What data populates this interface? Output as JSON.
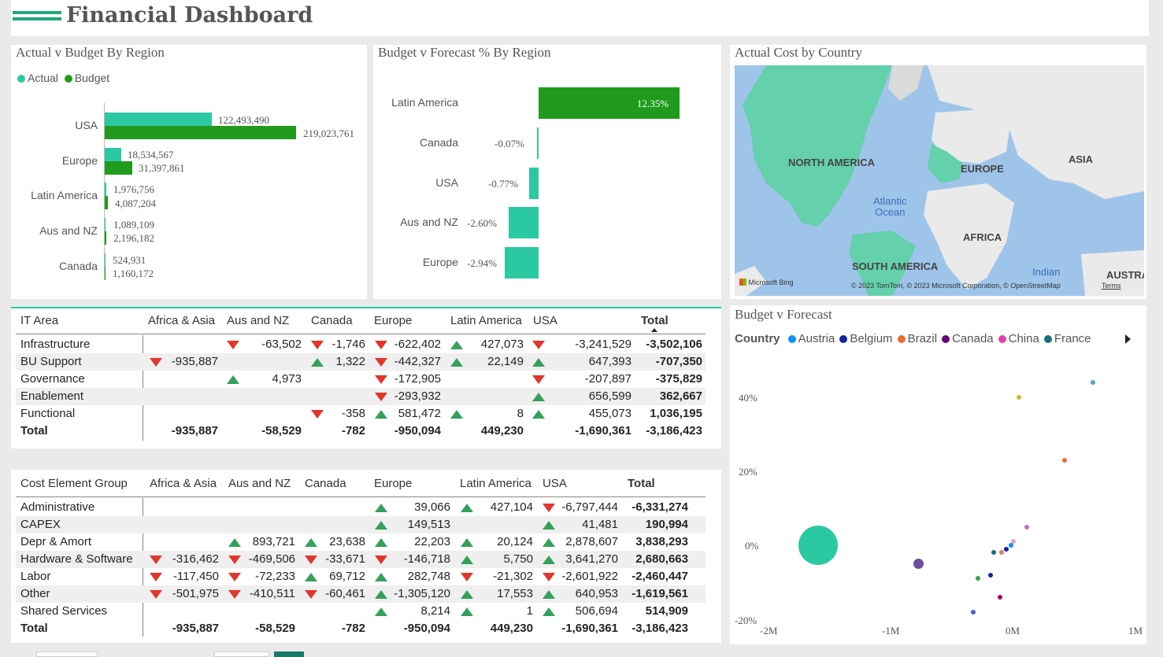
{
  "header": {
    "title": "Financial Dashboard"
  },
  "actual_v_budget": {
    "title": "Actual v Budget By Region",
    "legend": [
      {
        "label": "Actual",
        "color": "#2bc9a2"
      },
      {
        "label": "Budget",
        "color": "#209b1d"
      }
    ],
    "rows": [
      {
        "region": "USA",
        "actual": "122,493,490",
        "budget": "219,023,761"
      },
      {
        "region": "Europe",
        "actual": "18,534,567",
        "budget": "31,397,861"
      },
      {
        "region": "Latin America",
        "actual": "1,976,756",
        "budget": "4,087,204"
      },
      {
        "region": "Aus and NZ",
        "actual": "1,089,109",
        "budget": "2,196,182"
      },
      {
        "region": "Canada",
        "actual": "524,931",
        "budget": "1,160,172"
      }
    ]
  },
  "budget_v_forecast_pct": {
    "title": "Budget v Forecast % By Region",
    "rows": [
      {
        "region": "Latin America",
        "value": "12.35%"
      },
      {
        "region": "Canada",
        "value": "-0.07%"
      },
      {
        "region": "USA",
        "value": "-0.77%"
      },
      {
        "region": "Aus and NZ",
        "value": "-2.60%"
      },
      {
        "region": "Europe",
        "value": "-2.94%"
      }
    ]
  },
  "map": {
    "title": "Actual Cost by Country",
    "labels": {
      "north_america": "NORTH AMERICA",
      "europe": "EUROPE",
      "asia": "ASIA",
      "africa": "AFRICA",
      "south_america": "SOUTH AMERICA",
      "australia": "AUSTRA"
    },
    "oceans": {
      "atlantic": "Atlantic\nOcean",
      "indian": "Indian"
    },
    "bing": "Microsoft Bing",
    "copyright": "© 2023 TomTom, © 2023 Microsoft Corporation, © OpenStreetMap",
    "terms": "Terms"
  },
  "it_area_table": {
    "headers": [
      "IT Area",
      "Africa & Asia",
      "Aus and NZ",
      "Canada",
      "Europe",
      "Latin America",
      "USA",
      "Total"
    ],
    "rows": [
      {
        "label": "Infrastructure",
        "cells": [
          [
            "",
            ""
          ],
          [
            "down",
            "-63,502"
          ],
          [
            "down",
            "-1,746"
          ],
          [
            "down",
            "-622,402"
          ],
          [
            "up",
            "427,073"
          ],
          [
            "down",
            "-3,241,529"
          ]
        ],
        "total": "-3,502,106"
      },
      {
        "label": "BU Support",
        "cells": [
          [
            "down",
            "-935,887"
          ],
          [
            "",
            ""
          ],
          [
            "up",
            "1,322"
          ],
          [
            "down",
            "-442,327"
          ],
          [
            "up",
            "22,149"
          ],
          [
            "up",
            "647,393"
          ]
        ],
        "total": "-707,350"
      },
      {
        "label": "Governance",
        "cells": [
          [
            "",
            ""
          ],
          [
            "up",
            "4,973"
          ],
          [
            "",
            ""
          ],
          [
            "down",
            "-172,905"
          ],
          [
            "",
            ""
          ],
          [
            "down",
            "-207,897"
          ]
        ],
        "total": "-375,829"
      },
      {
        "label": "Enablement",
        "cells": [
          [
            "",
            ""
          ],
          [
            "",
            ""
          ],
          [
            "",
            ""
          ],
          [
            "down",
            "-293,932"
          ],
          [
            "",
            ""
          ],
          [
            "up",
            "656,599"
          ]
        ],
        "total": "362,667"
      },
      {
        "label": "Functional",
        "cells": [
          [
            "",
            ""
          ],
          [
            "",
            ""
          ],
          [
            "down",
            "-358"
          ],
          [
            "up",
            "581,472"
          ],
          [
            "up",
            "8"
          ],
          [
            "up",
            "455,073"
          ]
        ],
        "total": "1,036,195"
      }
    ],
    "total_row": {
      "label": "Total",
      "values": [
        "-935,887",
        "-58,529",
        "-782",
        "-950,094",
        "449,230",
        "-1,690,361",
        "-3,186,423"
      ]
    }
  },
  "cost_element_table": {
    "headers": [
      "Cost Element Group",
      "Africa & Asia",
      "Aus and NZ",
      "Canada",
      "Europe",
      "Latin America",
      "USA",
      "Total"
    ],
    "rows": [
      {
        "label": "Administrative",
        "cells": [
          [
            "",
            ""
          ],
          [
            "",
            ""
          ],
          [
            "",
            ""
          ],
          [
            "up",
            "39,066"
          ],
          [
            "up",
            "427,104"
          ],
          [
            "down",
            "-6,797,444"
          ]
        ],
        "total": "-6,331,274"
      },
      {
        "label": "CAPEX",
        "cells": [
          [
            "",
            ""
          ],
          [
            "",
            ""
          ],
          [
            "",
            ""
          ],
          [
            "up",
            "149,513"
          ],
          [
            "",
            ""
          ],
          [
            "up",
            "41,481"
          ]
        ],
        "total": "190,994"
      },
      {
        "label": "Depr & Amort",
        "cells": [
          [
            "",
            ""
          ],
          [
            "up",
            "893,721"
          ],
          [
            "up",
            "23,638"
          ],
          [
            "up",
            "22,203"
          ],
          [
            "up",
            "20,124"
          ],
          [
            "up",
            "2,878,607"
          ]
        ],
        "total": "3,838,293"
      },
      {
        "label": "Hardware & Software",
        "cells": [
          [
            "down",
            "-316,462"
          ],
          [
            "down",
            "-469,506"
          ],
          [
            "down",
            "-33,671"
          ],
          [
            "down",
            "-146,718"
          ],
          [
            "up",
            "5,750"
          ],
          [
            "up",
            "3,641,270"
          ]
        ],
        "total": "2,680,663"
      },
      {
        "label": "Labor",
        "cells": [
          [
            "down",
            "-117,450"
          ],
          [
            "down",
            "-72,233"
          ],
          [
            "up",
            "69,712"
          ],
          [
            "up",
            "282,748"
          ],
          [
            "down",
            "-21,302"
          ],
          [
            "down",
            "-2,601,922"
          ]
        ],
        "total": "-2,460,447"
      },
      {
        "label": "Other",
        "cells": [
          [
            "down",
            "-501,975"
          ],
          [
            "down",
            "-410,511"
          ],
          [
            "down",
            "-60,461"
          ],
          [
            "up",
            "-1,305,120"
          ],
          [
            "up",
            "17,553"
          ],
          [
            "up",
            "640,953"
          ]
        ],
        "total": "-1,619,561"
      },
      {
        "label": "Shared Services",
        "cells": [
          [
            "",
            ""
          ],
          [
            "",
            ""
          ],
          [
            "",
            ""
          ],
          [
            "up",
            "8,214"
          ],
          [
            "up",
            "1"
          ],
          [
            "up",
            "506,694"
          ]
        ],
        "total": "514,909"
      }
    ],
    "total_row": {
      "label": "Total",
      "values": [
        "-935,887",
        "-58,529",
        "-782",
        "-950,094",
        "449,230",
        "-1,690,361",
        "-3,186,423"
      ]
    }
  },
  "scatter": {
    "title": "Budget v Forecast",
    "legend_title": "Country",
    "legend": [
      {
        "label": "Austria",
        "color": "#118dff"
      },
      {
        "label": "Belgium",
        "color": "#12239e"
      },
      {
        "label": "Brazil",
        "color": "#e66c37"
      },
      {
        "label": "Canada",
        "color": "#6b007b"
      },
      {
        "label": "China",
        "color": "#e044a7"
      },
      {
        "label": "France",
        "color": "#197278"
      }
    ],
    "y_ticks": [
      "40%",
      "20%",
      "0%",
      "-20%"
    ],
    "x_ticks": [
      "-2M",
      "-1M",
      "0M",
      "1M"
    ]
  },
  "chart_data": [
    {
      "type": "bar",
      "title": "Actual v Budget By Region",
      "categories": [
        "USA",
        "Europe",
        "Latin America",
        "Aus and NZ",
        "Canada"
      ],
      "series": [
        {
          "name": "Actual",
          "values": [
            122493490,
            18534567,
            1976756,
            1089109,
            524931
          ]
        },
        {
          "name": "Budget",
          "values": [
            219023761,
            31397861,
            4087204,
            2196182,
            1160172
          ]
        }
      ]
    },
    {
      "type": "bar",
      "title": "Budget v Forecast % By Region",
      "categories": [
        "Latin America",
        "Canada",
        "USA",
        "Aus and NZ",
        "Europe"
      ],
      "values": [
        12.35,
        -0.07,
        -0.77,
        -2.6,
        -2.94
      ]
    },
    {
      "type": "scatter",
      "title": "Budget v Forecast",
      "xlim": [
        -2000000,
        1000000
      ],
      "ylim": [
        -20,
        40
      ],
      "points": [
        {
          "x": -1600000,
          "y": 0,
          "size": "large",
          "color": "#2bc9a2"
        },
        {
          "x": -780000,
          "y": -5,
          "color": "#6b4e9c"
        },
        {
          "x": 650000,
          "y": 44,
          "color": "#5b9bd5"
        },
        {
          "x": 45000,
          "y": 40,
          "color": "#c2c22a"
        },
        {
          "x": 420000,
          "y": 23,
          "color": "#e66c37"
        },
        {
          "x": 110000,
          "y": 5,
          "color": "#c66bd5"
        },
        {
          "x": 0,
          "y": 1,
          "color": "#e0a0d0"
        },
        {
          "x": -20000,
          "y": 0,
          "color": "#118dff"
        },
        {
          "x": -60000,
          "y": -1,
          "color": "#12239e"
        },
        {
          "x": -160000,
          "y": -2,
          "color": "#197278"
        },
        {
          "x": -100000,
          "y": -2,
          "color": "#e87878"
        },
        {
          "x": -190000,
          "y": -8,
          "color": "#12239e"
        },
        {
          "x": -290000,
          "y": -9,
          "color": "#37a04c"
        },
        {
          "x": -110000,
          "y": -14,
          "color": "#b0005a"
        },
        {
          "x": -330000,
          "y": -18,
          "color": "#4a5bd0"
        }
      ]
    }
  ]
}
